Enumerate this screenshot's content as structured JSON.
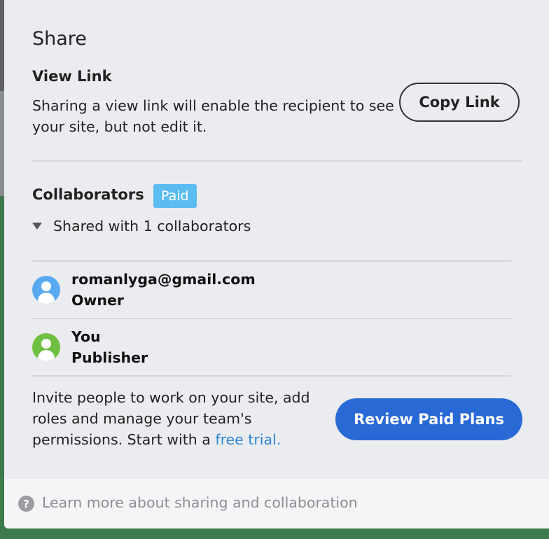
{
  "dialog": {
    "title": "Share",
    "view_link": {
      "heading": "View Link",
      "description": "Sharing a view link will enable the recipient to see your site, but not edit it.",
      "copy_button": "Copy Link"
    },
    "collaborators": {
      "heading": "Collaborators",
      "badge": "Paid",
      "shared_summary": "Shared with 1 collaborators",
      "members": [
        {
          "email": "romanlyga@gmail.com",
          "role": "Owner",
          "avatar_color": "#59a9f0",
          "icon": "user-icon"
        },
        {
          "email": "You",
          "role": "Publisher",
          "avatar_color": "#6fbf42",
          "icon": "user-icon"
        }
      ]
    },
    "invite": {
      "text": "Invite people to work on your site, add roles and manage your team's permissions. Start with a ",
      "link_text": "free trial.",
      "button": "Review Paid Plans"
    },
    "footer": {
      "help_icon": "?",
      "link_text": "Learn more about sharing and collaboration"
    }
  },
  "colors": {
    "accent": "#2869d5",
    "badge": "#5bbcf2",
    "link": "#2f86d9"
  }
}
